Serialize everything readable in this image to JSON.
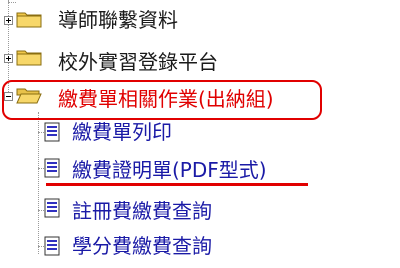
{
  "tree": {
    "items": [
      {
        "label": "導師聯繫資料",
        "type": "folder",
        "expanded": false
      },
      {
        "label": "校外實習登錄平台",
        "type": "folder",
        "expanded": false
      },
      {
        "label": "繳費單相關作業(出納組)",
        "type": "folder",
        "expanded": true
      }
    ],
    "children": [
      {
        "label": "繳費單列印"
      },
      {
        "label": "繳費證明單(PDF型式)"
      },
      {
        "label": "註冊費繳費查詢"
      },
      {
        "label": "學分費繳費查詢"
      }
    ]
  },
  "colors": {
    "folder_link": "#1a1a1a",
    "active_folder": "#e00000",
    "child_link": "#1a1aa6",
    "annotation": "#e10000"
  }
}
